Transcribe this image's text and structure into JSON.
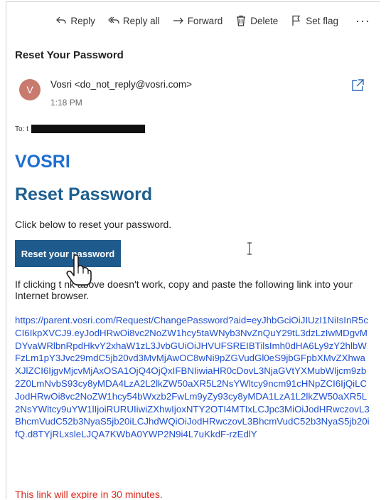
{
  "toolbar": {
    "reply": "Reply",
    "reply_all": "Reply all",
    "forward": "Forward",
    "delete": "Delete",
    "set_flag": "Set flag",
    "more": "···"
  },
  "email": {
    "subject": "Reset Your Password",
    "avatar_initial": "V",
    "avatar_color": "#c97a6e",
    "sender": "Vosri <do_not_reply@vosri.com>",
    "time": "1:18 PM",
    "to_label": "To: t"
  },
  "body": {
    "brand": "VOSRI",
    "heading": "Reset Password",
    "instructions": "Click below to reset your password.",
    "button_label": "Reset your password",
    "fallback_text": "If clicking t    nk above doesn't work, copy and paste the following link into your Internet browser.",
    "link": "https://parent.vosri.com/Request/ChangePassword?aid=eyJhbGciOiJIUzI1NiIsInR5cCI6IkpXVCJ9.eyJodHRwOi8vc2NoZW1hcy5taWNyb3NvZnQuY29tL3dzLzIwMDgvMDYvaWRlbnRpdHkvY2xhaW1zL3JvbGUiOiJHVUFSREIBTilsImh0dHA6Ly9zY2hlbWFzLm1pY3Jvc29mdC5jb20vd3MvMjAwOC8wNi9pZGVudGl0eS9jbGFpbXMvZXhwaXJlZCI6IjgvMjcvMjAxOSA1OjQ4OjQxIFBNIiwiaHR0cDovL3NjaGVtYXMubWljcm9zb2Z0LmNvbS93cy8yMDA4LzA2L2lkZW50aXR5L2NsYWltcy9ncm91cHNpZCI6IjQiLCJodHRwOi8vc2NoZW1hcy54bWxzb2FwLm9yZy93cy8yMDA1LzA1L2lkZW50aXR5L2NsYWltcy9uYW1lIjoiRURUIiwiZXhwIjoxNTY2OTI4MTIxLCJpc3MiOiJodHRwczovL3BhcmVudC52b3NyaS5jb20iLCJhdWQiOiJodHRwczovL3BhcmVudC52b3NyaS5jb20ifQ.d8TYjRLxsleLJQA7KWbA0YWP2N9i4L7uKkdF-rzEdlY",
    "expire_note": "This link will expire in 30 minutes.",
    "brand_color": "#1f6fd1",
    "button_color": "#1f5a8c",
    "warning_color": "#d9291c"
  }
}
